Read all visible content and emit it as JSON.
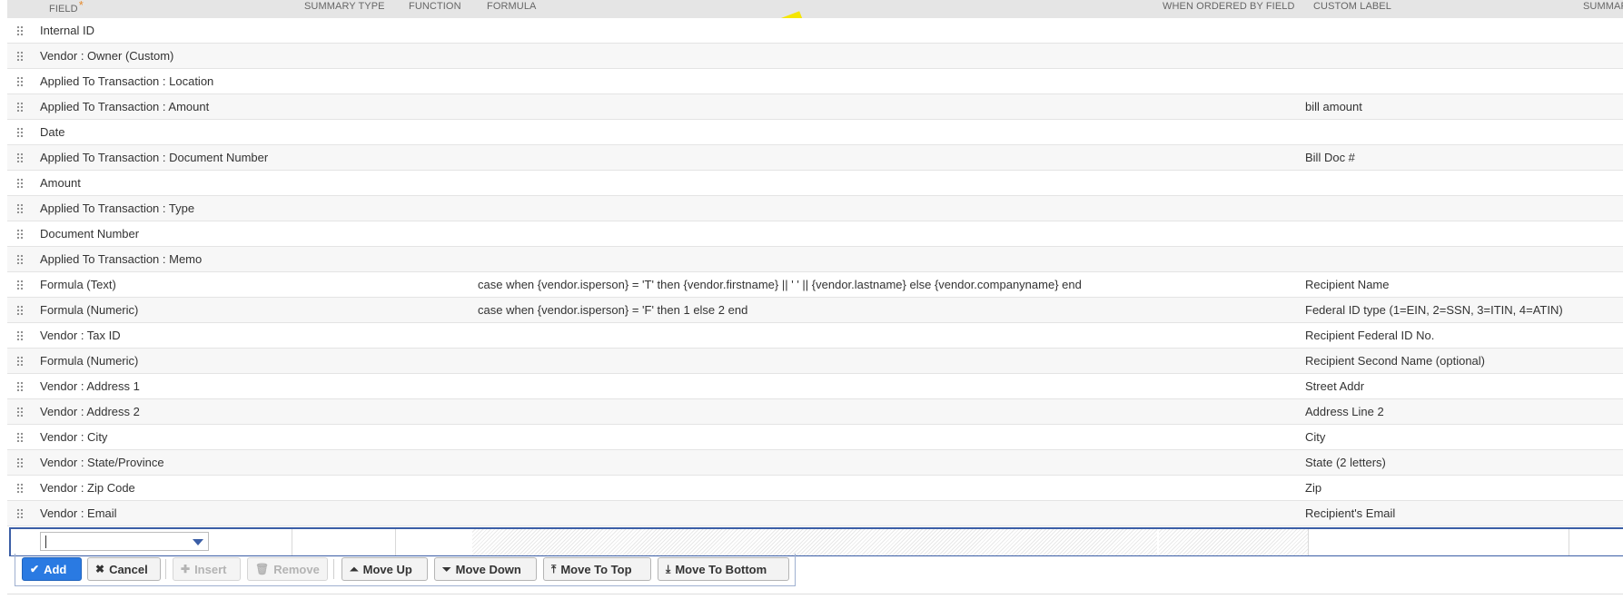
{
  "columns": {
    "field": "FIELD",
    "summary_type": "SUMMARY TYPE",
    "function": "FUNCTION",
    "formula": "FORMULA",
    "when_ordered_by_field": "WHEN ORDERED BY FIELD",
    "custom_label": "CUSTOM LABEL",
    "summary_label": "SUMMAF",
    "required_marker": "*"
  },
  "rows": [
    {
      "field": "Internal ID",
      "formula": "",
      "label": ""
    },
    {
      "field": "Vendor : Owner (Custom)",
      "formula": "",
      "label": ""
    },
    {
      "field": "Applied To Transaction : Location",
      "formula": "",
      "label": ""
    },
    {
      "field": "Applied To Transaction : Amount",
      "formula": "",
      "label": "bill amount"
    },
    {
      "field": "Date",
      "formula": "",
      "label": ""
    },
    {
      "field": "Applied To Transaction : Document Number",
      "formula": "",
      "label": "Bill Doc #"
    },
    {
      "field": "Amount",
      "formula": "",
      "label": ""
    },
    {
      "field": "Applied To Transaction : Type",
      "formula": "",
      "label": ""
    },
    {
      "field": "Document Number",
      "formula": "",
      "label": ""
    },
    {
      "field": "Applied To Transaction : Memo",
      "formula": "",
      "label": ""
    },
    {
      "field": "Formula (Text)",
      "formula": "case when {vendor.isperson} = 'T' then {vendor.firstname} || ' ' || {vendor.lastname} else {vendor.companyname} end",
      "label": "Recipient Name"
    },
    {
      "field": "Formula (Numeric)",
      "formula": "case when {vendor.isperson} = 'F' then 1 else 2 end",
      "label": "Federal ID type (1=EIN, 2=SSN, 3=ITIN, 4=ATIN)"
    },
    {
      "field": "Vendor : Tax ID",
      "formula": "",
      "label": "Recipient Federal ID No."
    },
    {
      "field": "Formula (Numeric)",
      "formula": "",
      "label": "Recipient Second Name (optional)"
    },
    {
      "field": "Vendor : Address 1",
      "formula": "",
      "label": "Street Addr"
    },
    {
      "field": "Vendor : Address 2",
      "formula": "",
      "label": "Address Line 2"
    },
    {
      "field": "Vendor : City",
      "formula": "",
      "label": "City"
    },
    {
      "field": "Vendor : State/Province",
      "formula": "",
      "label": "State (2 letters)"
    },
    {
      "field": "Vendor : Zip Code",
      "formula": "",
      "label": "Zip"
    },
    {
      "field": "Vendor : Email",
      "formula": "",
      "label": "Recipient's Email"
    }
  ],
  "edit_row": {
    "field_value": ""
  },
  "toolbar": {
    "add": "Add",
    "cancel": "Cancel",
    "insert": "Insert",
    "remove": "Remove",
    "move_up": "Move Up",
    "move_down": "Move Down",
    "move_to_top": "Move To Top",
    "move_to_bottom": "Move To Bottom"
  },
  "colors": {
    "primary_button": "#2a7ae2",
    "edit_border": "#3b5ea6",
    "highlight_mark": "#f5e600"
  }
}
